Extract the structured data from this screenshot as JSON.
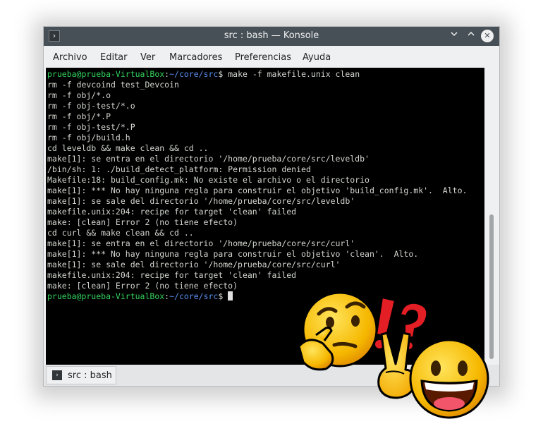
{
  "window": {
    "title": "src : bash — Konsole",
    "app_icon": "terminal-icon",
    "controls": [
      "minimize-icon",
      "maximize-icon",
      "close-icon"
    ]
  },
  "menu": [
    "Archivo",
    "Editar",
    "Ver",
    "Marcadores",
    "Preferencias",
    "Ayuda"
  ],
  "terminal": {
    "prompt_user": "prueba@prueba-VirtualBox",
    "prompt_path": "~/core/src",
    "prompt_symbol": "$",
    "command": " make -f makefile.unix clean",
    "output": [
      "rm -f devcoind test_Devcoin",
      "rm -f obj/*.o",
      "rm -f obj-test/*.o",
      "rm -f obj/*.P",
      "rm -f obj-test/*.P",
      "rm -f obj/build.h",
      "cd leveldb && make clean && cd ..",
      "make[1]: se entra en el directorio '/home/prueba/core/src/leveldb'",
      "/bin/sh: 1: ./build_detect_platform: Permission denied",
      "Makefile:18: build_config.mk: No existe el archivo o el directorio",
      "make[1]: *** No hay ninguna regla para construir el objetivo 'build_config.mk'.  Alto.",
      "make[1]: se sale del directorio '/home/prueba/core/src/leveldb'",
      "makefile.unix:204: recipe for target 'clean' failed",
      "make: [clean] Error 2 (no tiene efecto)",
      "cd curl && make clean && cd ..",
      "make[1]: se entra en el directorio '/home/prueba/core/src/curl'",
      "make[1]: *** No hay ninguna regla para construir el objetivo 'clean'.  Alto.",
      "make[1]: se sale del directorio '/home/prueba/core/src/curl'",
      "makefile.unix:204: recipe for target 'clean' failed",
      "make: [clean] Error 2 (no tiene efecto)"
    ]
  },
  "tabs": [
    {
      "label": "src : bash",
      "icon": "terminal-icon"
    }
  ],
  "colors": {
    "prompt_user": "#33d35e",
    "prompt_path": "#5b8ef3",
    "terminal_bg": "#000000",
    "terminal_fg": "#d3d7cf",
    "titlebar": "#475057"
  },
  "overlays": [
    "thinking-face-emoji",
    "exclamation-question-icon",
    "laughing-face-emoji",
    "victory-hand-emoji"
  ]
}
